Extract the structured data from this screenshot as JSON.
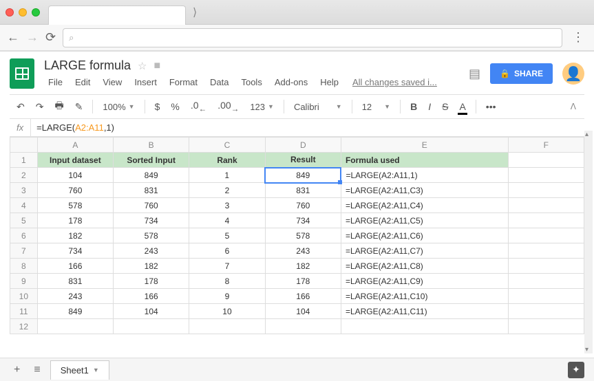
{
  "doc": {
    "title": "LARGE formula",
    "save_status": "All changes saved i..."
  },
  "menu": {
    "file": "File",
    "edit": "Edit",
    "view": "View",
    "insert": "Insert",
    "format": "Format",
    "data": "Data",
    "tools": "Tools",
    "addons": "Add-ons",
    "help": "Help"
  },
  "share": {
    "label": "SHARE"
  },
  "toolbar": {
    "zoom": "100%",
    "font": "Calibri",
    "size": "12",
    "dollar": "$",
    "percent": "%",
    "dec_dec": ".0",
    "dec_inc": ".00",
    "more_fmt": "123",
    "bold": "B",
    "italic": "I",
    "strike": "S",
    "color": "A",
    "more": "•••"
  },
  "formula_bar": {
    "fx": "fx",
    "prefix": "=LARGE(",
    "range": "A2:A11",
    "suffix": ",1)"
  },
  "columns": [
    "A",
    "B",
    "C",
    "D",
    "E",
    "F"
  ],
  "headers": {
    "A": "Input dataset",
    "B": "Sorted Input",
    "C": "Rank",
    "D": "Result",
    "E": "Formula used"
  },
  "rows": [
    {
      "n": "1"
    },
    {
      "n": "2",
      "A": "104",
      "B": "849",
      "C": "1",
      "D": "849",
      "E": "=LARGE(A2:A11,1)"
    },
    {
      "n": "3",
      "A": "760",
      "B": "831",
      "C": "2",
      "D": "831",
      "E": "=LARGE(A2:A11,C3)"
    },
    {
      "n": "4",
      "A": "578",
      "B": "760",
      "C": "3",
      "D": "760",
      "E": "=LARGE(A2:A11,C4)"
    },
    {
      "n": "5",
      "A": "178",
      "B": "734",
      "C": "4",
      "D": "734",
      "E": "=LARGE(A2:A11,C5)"
    },
    {
      "n": "6",
      "A": "182",
      "B": "578",
      "C": "5",
      "D": "578",
      "E": "=LARGE(A2:A11,C6)"
    },
    {
      "n": "7",
      "A": "734",
      "B": "243",
      "C": "6",
      "D": "243",
      "E": "=LARGE(A2:A11,C7)"
    },
    {
      "n": "8",
      "A": "166",
      "B": "182",
      "C": "7",
      "D": "182",
      "E": "=LARGE(A2:A11,C8)"
    },
    {
      "n": "9",
      "A": "831",
      "B": "178",
      "C": "8",
      "D": "178",
      "E": "=LARGE(A2:A11,C9)"
    },
    {
      "n": "10",
      "A": "243",
      "B": "166",
      "C": "9",
      "D": "166",
      "E": "=LARGE(A2:A11,C10)"
    },
    {
      "n": "11",
      "A": "849",
      "B": "104",
      "C": "10",
      "D": "104",
      "E": "=LARGE(A2:A11,C11)"
    },
    {
      "n": "12"
    }
  ],
  "selected_cell": "D2",
  "sheet_tabs": {
    "sheet1": "Sheet1"
  }
}
